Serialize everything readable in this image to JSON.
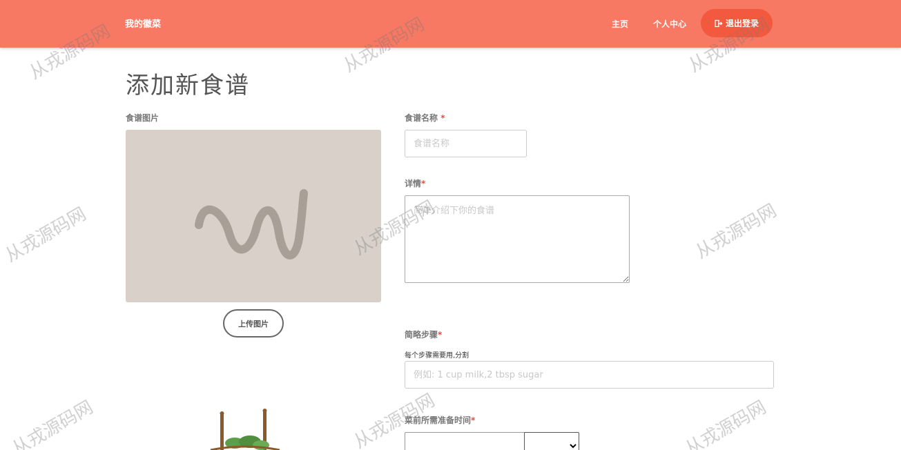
{
  "nav": {
    "brand": "我的徽菜",
    "home": "主页",
    "profile": "个人中心",
    "logout": "退出登录",
    "logout_icon": "sign-out-icon"
  },
  "page": {
    "title": "添加新食谱"
  },
  "form": {
    "image_label": "食谱图片",
    "upload_button": "上传图片",
    "name_label": "食谱名称",
    "name_placeholder": "食谱名称",
    "detail_label": "详情",
    "detail_placeholder": "简单介绍下你的食谱",
    "steps_label": "简略步骤",
    "steps_hint": "每个步骤需要用,分割",
    "steps_placeholder": "例如: 1 cup milk,2 tbsp sugar",
    "prep_time_label": "菜前所需准备时间",
    "prep_time_value": "",
    "required_mark": "*"
  },
  "watermark": "从戎源码网",
  "colors": {
    "navbar": "#f77964",
    "logout_button": "#f2593e",
    "image_placeholder_bg": "#d8d0c9",
    "image_placeholder_stroke": "#a8a096",
    "required": "#e74c3c"
  }
}
